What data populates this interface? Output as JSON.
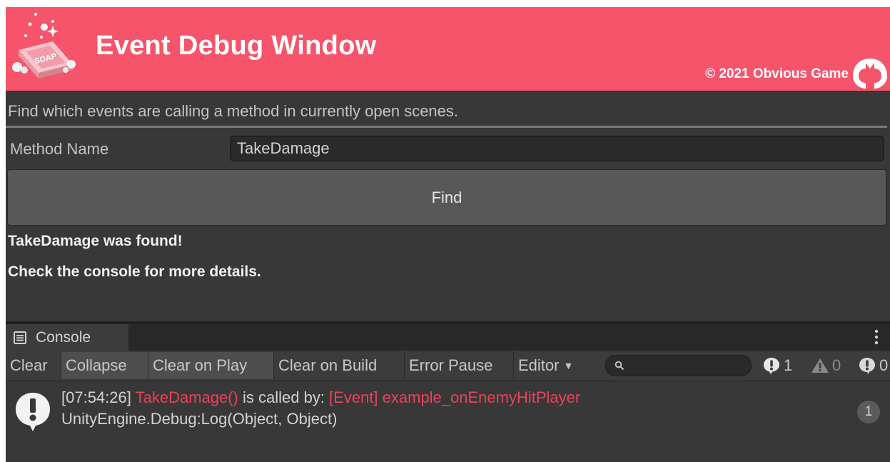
{
  "banner": {
    "title": "Event Debug Window",
    "copyright": "© 2021 Obvious Game",
    "logo_icon": "soap-logo",
    "brand_icon": "obvious-game-mark"
  },
  "panel": {
    "description": "Find which events are calling a method in currently open scenes.",
    "method_label": "Method Name",
    "method_value": "TakeDamage",
    "find_button": "Find",
    "result_line1": "TakeDamage was found!",
    "result_line2": "Check the console for more details."
  },
  "console": {
    "tab_label": "Console",
    "tab_icon": "console-icon",
    "toolbar": {
      "clear": "Clear",
      "collapse": "Collapse",
      "clear_on_play": "Clear on Play",
      "clear_on_build": "Clear on Build",
      "error_pause": "Error Pause",
      "editor": "Editor",
      "search_value": "",
      "info_count": "1",
      "warning_count": "0",
      "error_count": "0"
    },
    "log": {
      "timestamp": "[07:54:26]",
      "method": "TakeDamage()",
      "called_by": " is called by: ",
      "event_name": "[Event] example_onEnemyHitPlayer",
      "stack": "UnityEngine.Debug:Log(Object, Object)",
      "count": "1"
    }
  },
  "colors": {
    "banner": "#f6546a",
    "highlight_red": "#e8445a",
    "panel_bg": "#383838"
  }
}
